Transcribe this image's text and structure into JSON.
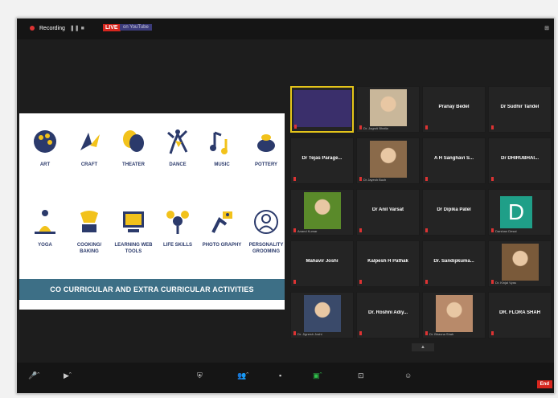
{
  "window": {
    "recording_label": "Recording",
    "live_label": "LIVE",
    "live_status": "on YouTube",
    "view_label": "View"
  },
  "slide": {
    "activities": [
      {
        "label": "ART",
        "icon": "palette-icon"
      },
      {
        "label": "CRAFT",
        "icon": "craft-icon"
      },
      {
        "label": "THEATER",
        "icon": "theater-masks-icon"
      },
      {
        "label": "DANCE",
        "icon": "dancer-icon"
      },
      {
        "label": "MUSIC",
        "icon": "music-notes-icon"
      },
      {
        "label": "POTTERY",
        "icon": "pottery-icon"
      },
      {
        "label": "YOGA",
        "icon": "yoga-icon"
      },
      {
        "label": "COOKING/ BAKING",
        "icon": "cooking-icon"
      },
      {
        "label": "LEARNING WEB TOOLS",
        "icon": "computer-icon"
      },
      {
        "label": "LIFE SKILLS",
        "icon": "life-skills-icon"
      },
      {
        "label": "PHOTO GRAPHY",
        "icon": "camera-icon"
      },
      {
        "label": "PERSONALITY GROOMING",
        "icon": "personality-icon"
      }
    ],
    "banner": "CO CURRICULAR AND EXTRA CURRICULAR ACTIVITIES"
  },
  "participants": [
    {
      "name": "",
      "caption": "",
      "video": true,
      "active": true
    },
    {
      "name": "",
      "caption": "Dr. Jagruti Bhatia",
      "video": true
    },
    {
      "name": "Pranay Bedel",
      "caption": "",
      "video": false
    },
    {
      "name": "Dr Sudhir Tandel",
      "caption": "",
      "video": false
    },
    {
      "name": "Dr Tejas Parage...",
      "caption": "",
      "video": false
    },
    {
      "name": "",
      "caption": "Dr Jayesh Buch",
      "video": true
    },
    {
      "name": "A H Sanghavi S...",
      "caption": "",
      "video": false
    },
    {
      "name": "Dr DHIRUBHAI...",
      "caption": "",
      "video": false
    },
    {
      "name": "",
      "caption": "Anand Kumar",
      "video": true
    },
    {
      "name": "Dr Anil Varsat",
      "caption": "",
      "video": false
    },
    {
      "name": "Dr Dipika Patel",
      "caption": "",
      "video": false
    },
    {
      "name": "",
      "caption": "Darshan Desai",
      "video": false,
      "avatar": "D"
    },
    {
      "name": "Mahavir Joshi",
      "caption": "",
      "video": false
    },
    {
      "name": "Kalpesh H Pathak",
      "caption": "",
      "video": false
    },
    {
      "name": "Dr. Sandipkuma...",
      "caption": "",
      "video": false
    },
    {
      "name": "",
      "caption": "Dr. Kinjal Vyas",
      "video": true
    },
    {
      "name": "",
      "caption": "Dr. Jignesh Joshi",
      "video": true
    },
    {
      "name": "Dr. Roshni Adiy...",
      "caption": "",
      "video": false
    },
    {
      "name": "",
      "caption": "Dr. Bhavna Shah",
      "video": true
    },
    {
      "name": "DR. FLORA SHAH",
      "caption": "",
      "video": false
    }
  ],
  "toolbar": {
    "end_label": "End"
  },
  "colors": {
    "slide_banner": "#3d6f86",
    "live_red": "#d6261e",
    "active_speaker": "#e5c51a",
    "avatar_teal": "#1f9f88"
  }
}
